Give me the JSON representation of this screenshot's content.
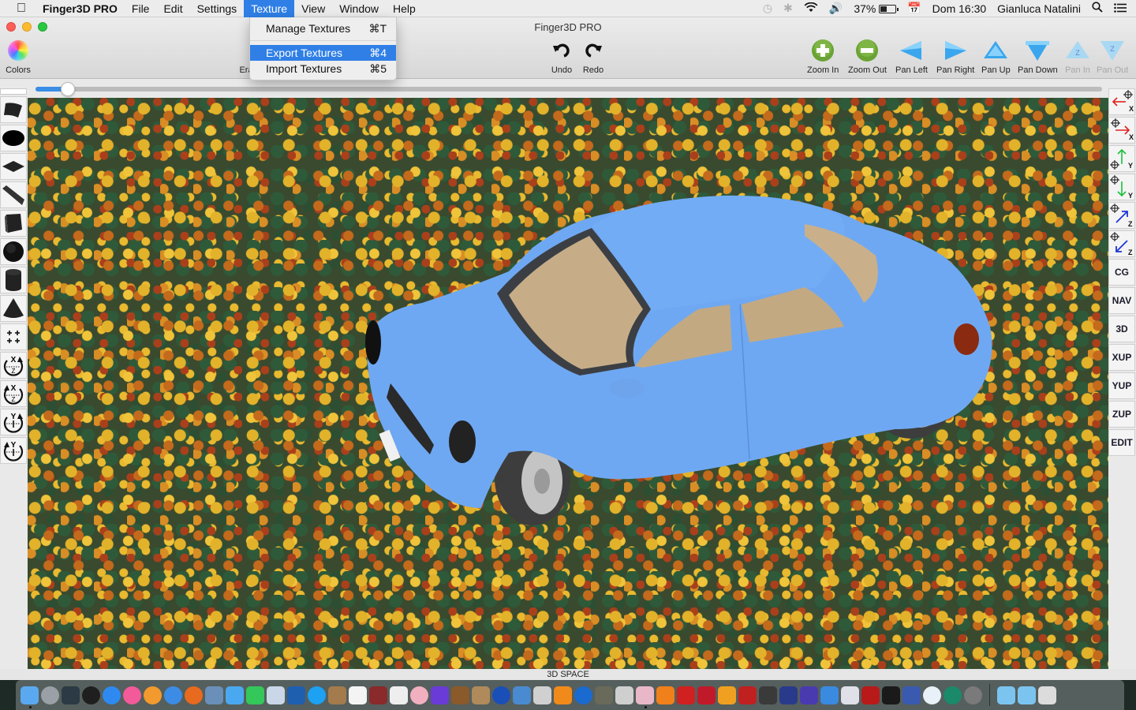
{
  "menubar": {
    "app_name": "Finger3D PRO",
    "items": [
      "File",
      "Edit",
      "Settings",
      "Texture",
      "View",
      "Window",
      "Help"
    ],
    "active_item": "Texture",
    "status": {
      "battery_percent": "37%",
      "clock": "Dom 16:30",
      "user": "Gianluca Natalini"
    }
  },
  "window": {
    "title": "Finger3D PRO",
    "toolbar": {
      "colors_label": "Colors",
      "erase_label_partial": "Era",
      "undo_label": "Undo",
      "redo_label": "Redo",
      "nav_buttons": [
        {
          "label": "Zoom In",
          "icon": "zoom-in-icon",
          "enabled": true
        },
        {
          "label": "Zoom Out",
          "icon": "zoom-out-icon",
          "enabled": true
        },
        {
          "label": "Pan Left",
          "icon": "pan-left-icon",
          "enabled": true
        },
        {
          "label": "Pan Right",
          "icon": "pan-right-icon",
          "enabled": true
        },
        {
          "label": "Pan Up",
          "icon": "pan-up-icon",
          "enabled": true
        },
        {
          "label": "Pan Down",
          "icon": "pan-down-icon",
          "enabled": true
        },
        {
          "label": "Pan In",
          "icon": "pan-in-icon",
          "enabled": false
        },
        {
          "label": "Pan Out",
          "icon": "pan-out-icon",
          "enabled": false
        }
      ]
    },
    "slider_value_fraction": 0.03
  },
  "texture_menu": {
    "items": [
      {
        "label": "Manage Textures",
        "shortcut": "⌘T",
        "highlighted": false
      },
      {
        "label": "Export Textures",
        "shortcut": "⌘4",
        "highlighted": true
      },
      {
        "label": "Import Textures",
        "shortcut": "⌘5",
        "highlighted": false
      }
    ]
  },
  "left_tools": [
    "curved-surface-tool",
    "ellipse-tool",
    "plane-tool",
    "ribbon-tool",
    "cube-tool",
    "sphere-tool",
    "cylinder-tool",
    "cone-tool",
    "grid-snap-tool",
    "rotate-xz-cw-tool",
    "rotate-xz-ccw-tool",
    "rotate-y-cw-tool",
    "rotate-y-ccw-tool"
  ],
  "right_tools": {
    "axis_moves": [
      {
        "name": "move-neg-x",
        "axis": "X",
        "color": "#e02020"
      },
      {
        "name": "move-pos-x",
        "axis": "X",
        "color": "#e02020"
      },
      {
        "name": "move-pos-y",
        "axis": "Y",
        "color": "#18c13a"
      },
      {
        "name": "move-neg-y",
        "axis": "Y",
        "color": "#18c13a"
      },
      {
        "name": "move-pos-z",
        "axis": "Z",
        "color": "#1c35d6"
      },
      {
        "name": "move-neg-z",
        "axis": "Z",
        "color": "#1c35d6"
      }
    ],
    "modes": [
      "CG",
      "NAV",
      "3D",
      "XUP",
      "YUP",
      "ZUP",
      "EDIT"
    ]
  },
  "viewport": {
    "label": "3D SPACE",
    "model": "blue car",
    "car_color": "#6fa8f2",
    "texture": "marigold flowers"
  },
  "dock": {
    "apps": [
      {
        "name": "Finder",
        "color": "#5aa9f0",
        "running": true
      },
      {
        "name": "Launchpad",
        "color": "#9aa0a6"
      },
      {
        "name": "Mission Control",
        "color": "#2b3a44"
      },
      {
        "name": "Dashboard",
        "color": "#1f1f1f"
      },
      {
        "name": "App Store",
        "color": "#2e8af0"
      },
      {
        "name": "iTunes",
        "color": "#f25a9a"
      },
      {
        "name": "iBooks",
        "color": "#f29a2e"
      },
      {
        "name": "Safari",
        "color": "#3c8ce6"
      },
      {
        "name": "Firefox",
        "color": "#e86a1e"
      },
      {
        "name": "Preview",
        "color": "#6a8fb8"
      },
      {
        "name": "Messages",
        "color": "#4aa8f0"
      },
      {
        "name": "FaceTime",
        "color": "#34c759"
      },
      {
        "name": "Photo Booth Utility",
        "color": "#c9d7e8"
      },
      {
        "name": "OpenOffice",
        "color": "#1f5fb0"
      },
      {
        "name": "Skype",
        "color": "#1da1f2"
      },
      {
        "name": "Contacts",
        "color": "#a37b4c"
      },
      {
        "name": "Calendar",
        "color": "#f4f4f4"
      },
      {
        "name": "Photo Booth",
        "color": "#8a2a2a"
      },
      {
        "name": "TextEdit",
        "color": "#eeeeee"
      },
      {
        "name": "Photos",
        "color": "#f0b0c0"
      },
      {
        "name": "iMovie",
        "color": "#6a3bd6"
      },
      {
        "name": "GarageBand",
        "color": "#8a5a2a"
      },
      {
        "name": "iPhoto",
        "color": "#b08a5a"
      },
      {
        "name": "DVD Player",
        "color": "#1a4fb8"
      },
      {
        "name": "Boot Camp Assistant",
        "color": "#4a8ad0"
      },
      {
        "name": "Disk Utility",
        "color": "#d0d0d0"
      },
      {
        "name": "VLC",
        "color": "#f08a1a"
      },
      {
        "name": "QuickTime",
        "color": "#1a6ad0"
      },
      {
        "name": "GIMP",
        "color": "#6a6a5a"
      },
      {
        "name": "Maze App",
        "color": "#cfcfcf"
      },
      {
        "name": "Poser",
        "color": "#e8b8c8",
        "running": true
      },
      {
        "name": "Blender",
        "color": "#f0801a"
      },
      {
        "name": "SketchUp",
        "color": "#d02020"
      },
      {
        "name": "CDA App",
        "color": "#c01a2a"
      },
      {
        "name": "Audacity",
        "color": "#f0a020"
      },
      {
        "name": "Joystick App",
        "color": "#c02020"
      },
      {
        "name": "Emulator",
        "color": "#3a3a3a"
      },
      {
        "name": "FS-UAE",
        "color": "#2a3a8a"
      },
      {
        "name": "Purple Screen App",
        "color": "#4a3ab0"
      },
      {
        "name": "Xcode",
        "color": "#3a8ae0"
      },
      {
        "name": "Printer Utility",
        "color": "#e0e0e8"
      },
      {
        "name": "FileZilla",
        "color": "#b81a1a"
      },
      {
        "name": "Terminal",
        "color": "#1a1a1a"
      },
      {
        "name": "HP Scan",
        "color": "#3a5ab0"
      },
      {
        "name": "Printer",
        "color": "#e8f0f8"
      },
      {
        "name": "Time Machine",
        "color": "#1a8a6a"
      },
      {
        "name": "System Preferences",
        "color": "#7a7a7a"
      }
    ],
    "folders": [
      {
        "name": "Applications",
        "color": "#7cc4f0"
      },
      {
        "name": "Downloads",
        "color": "#7cc4f0"
      },
      {
        "name": "Trash",
        "color": "#dcdcdc"
      }
    ]
  }
}
